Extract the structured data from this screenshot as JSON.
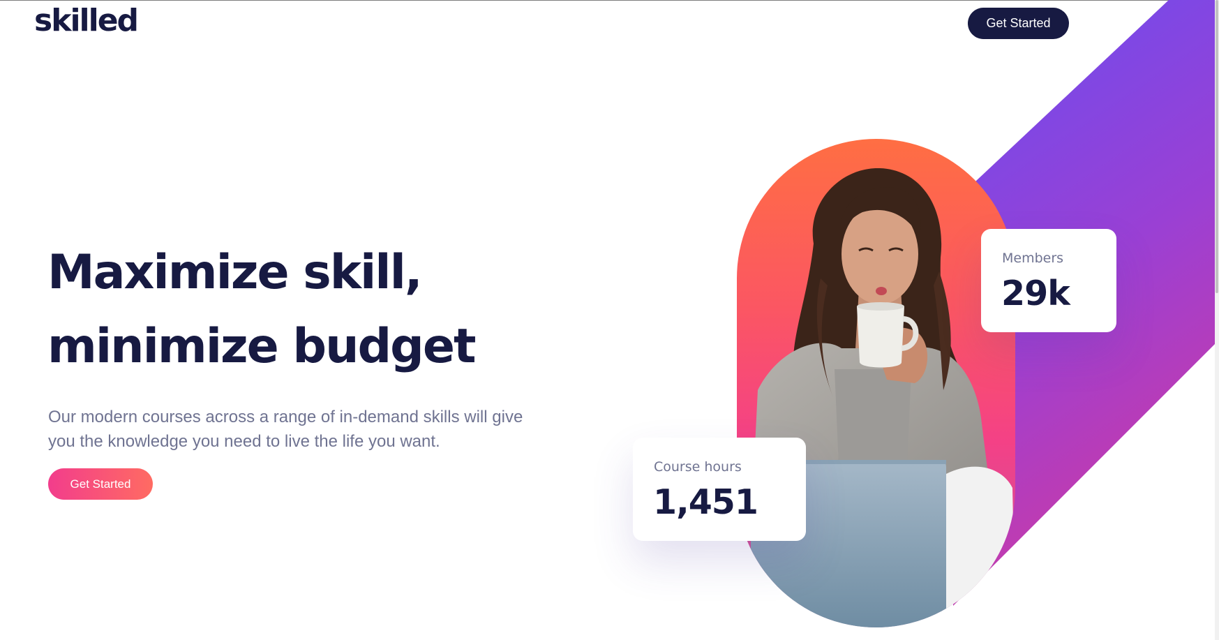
{
  "header": {
    "logo_text": "skilled",
    "cta_label": "Get Started"
  },
  "hero": {
    "headline_line1": "Maximize skill,",
    "headline_line2": "minimize budget",
    "description": "Our modern courses across a range of in-demand skills will give you the knowledge you need to live the life you want.",
    "cta_label": "Get Started"
  },
  "stats": {
    "members": {
      "label": "Members",
      "value": "29k"
    },
    "course_hours": {
      "label": "Course hours",
      "value": "1,451"
    }
  },
  "colors": {
    "navy": "#171a42",
    "muted_text": "#6f7391",
    "cta_gradient_start": "#f23d8c",
    "cta_gradient_end": "#ff6b62",
    "band_gradient_top": "#6a4df0",
    "band_gradient_bottom": "#c93aa8",
    "pill_gradient_top": "#ff6e43",
    "pill_gradient_bottom": "#f44186"
  },
  "icons": {
    "hero_image": "woman-drinking-coffee-photo"
  }
}
